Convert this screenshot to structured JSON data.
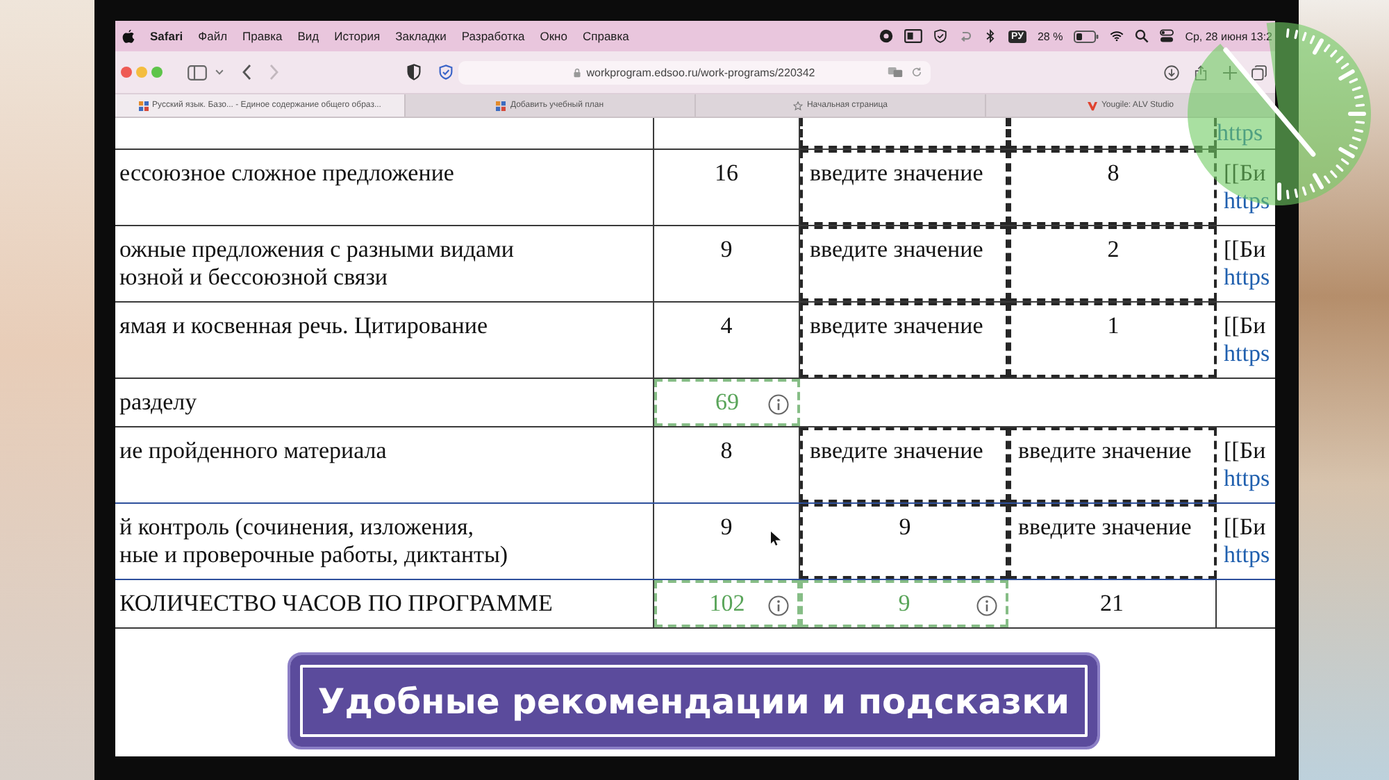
{
  "menu_bar": {
    "app_name": "Safari",
    "menus": [
      "Файл",
      "Правка",
      "Вид",
      "История",
      "Закладки",
      "Разработка",
      "Окно",
      "Справка"
    ],
    "input_source": "РУ",
    "battery": "28 %",
    "clock": "Ср, 28 июня 13:2"
  },
  "toolbar": {
    "nav": [
      {
        "kind": "back",
        "disabled": false
      },
      {
        "kind": "forward",
        "disabled": true
      }
    ],
    "address": "workprogram.edsoo.ru/work-programs/220342"
  },
  "tabs": [
    {
      "kind": "site",
      "title": "Русский язык. Базо... - Единое содержание общего образ...",
      "selected": true
    },
    {
      "kind": "site",
      "title": "Добавить учебный план",
      "selected": false
    },
    {
      "kind": "star",
      "title": "Начальная страница",
      "selected": false
    },
    {
      "kind": "app",
      "title": "Yougile: ALV Studio",
      "selected": false
    }
  ],
  "table": {
    "rows": [
      {
        "kind": "cut",
        "hovered": false,
        "cells": [
          {
            "kind": "blank"
          },
          {
            "kind": "blank"
          },
          {
            "kind": "input"
          },
          {
            "kind": "input"
          },
          {
            "kind": "resource",
            "link": "https"
          }
        ]
      },
      {
        "kind": "item",
        "hovered": false,
        "cells": [
          {
            "kind": "topic",
            "lines": [
              "ессоюзное сложное предложение"
            ]
          },
          {
            "kind": "number",
            "text": "16"
          },
          {
            "kind": "input",
            "placeholder": "введите значение"
          },
          {
            "kind": "input",
            "value": "8"
          },
          {
            "kind": "resource",
            "text": "[[Би",
            "link": "https"
          }
        ]
      },
      {
        "kind": "item",
        "hovered": false,
        "cells": [
          {
            "kind": "topic",
            "lines": [
              "ожные предложения с разными видами",
              "юзной и бессоюзной связи"
            ]
          },
          {
            "kind": "number",
            "text": "9"
          },
          {
            "kind": "input",
            "placeholder": "введите значение"
          },
          {
            "kind": "input",
            "value": "2"
          },
          {
            "kind": "resource",
            "text": "[[Би",
            "link": "https"
          }
        ]
      },
      {
        "kind": "item",
        "hovered": false,
        "cells": [
          {
            "kind": "topic",
            "lines": [
              "ямая и косвенная речь. Цитирование"
            ]
          },
          {
            "kind": "number",
            "text": "4"
          },
          {
            "kind": "input",
            "placeholder": "введите значение"
          },
          {
            "kind": "input",
            "value": "1"
          },
          {
            "kind": "resource",
            "text": "[[Би",
            "link": "https"
          }
        ]
      },
      {
        "kind": "item",
        "hovered": false,
        "cells": [
          {
            "kind": "topic",
            "lines": [
              "разделу"
            ]
          },
          {
            "kind": "total",
            "text": "69"
          },
          {
            "kind": "blank_wide"
          }
        ]
      },
      {
        "kind": "item",
        "hovered": false,
        "cells": [
          {
            "kind": "topic",
            "lines": [
              "ие пройденного материала"
            ]
          },
          {
            "kind": "number",
            "text": "8"
          },
          {
            "kind": "input",
            "placeholder": "введите значение"
          },
          {
            "kind": "input",
            "placeholder": "введите значение"
          },
          {
            "kind": "resource",
            "text": "[[Би",
            "link": "https"
          }
        ]
      },
      {
        "kind": "item",
        "hovered": true,
        "cells": [
          {
            "kind": "topic",
            "lines": [
              "й контроль (сочинения, изложения,",
              "ные и проверочные работы, диктанты)"
            ]
          },
          {
            "kind": "number",
            "text": "9",
            "pointer": true
          },
          {
            "kind": "input",
            "value": "9"
          },
          {
            "kind": "input",
            "placeholder": "введите значение"
          },
          {
            "kind": "resource",
            "text": "[[Би",
            "link": "https"
          }
        ]
      },
      {
        "kind": "item",
        "hovered": false,
        "cells": [
          {
            "kind": "topic",
            "lines": [
              "КОЛИЧЕСТВО ЧАСОВ ПО ПРОГРАММЕ"
            ]
          },
          {
            "kind": "total",
            "text": "102"
          },
          {
            "kind": "total",
            "text": "9"
          },
          {
            "kind": "number",
            "text": "21"
          },
          {
            "kind": "blank"
          }
        ]
      }
    ]
  },
  "caption": {
    "text": "Удобные рекомендации и подсказки"
  }
}
